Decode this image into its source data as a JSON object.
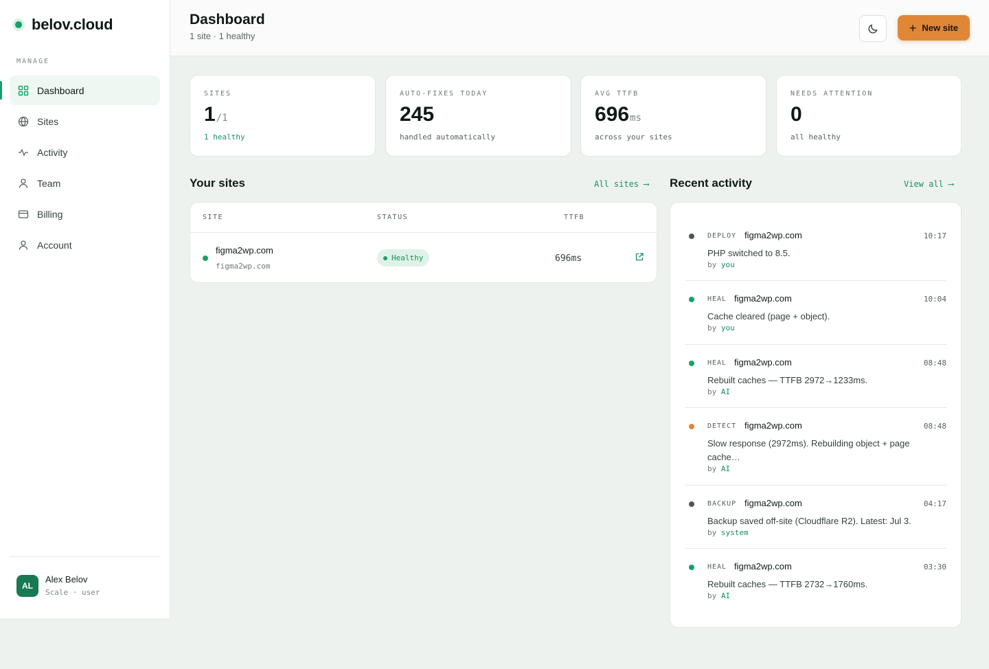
{
  "brand": {
    "name": "belov.cloud"
  },
  "sidebar": {
    "heading": "MANAGE",
    "items": [
      {
        "label": "Dashboard",
        "icon": "grid-icon",
        "active": true
      },
      {
        "label": "Sites",
        "icon": "globe-icon"
      },
      {
        "label": "Activity",
        "icon": "pulse-icon"
      },
      {
        "label": "Team",
        "icon": "person-icon"
      },
      {
        "label": "Billing",
        "icon": "card-icon"
      },
      {
        "label": "Account",
        "icon": "person-icon"
      }
    ],
    "user": {
      "initials": "AL",
      "name": "Alex Belov",
      "plan": "Scale · user"
    }
  },
  "header": {
    "title": "Dashboard",
    "subtitle": "1 site · 1 healthy",
    "theme_icon": "moon-icon",
    "new_site_label": "New site"
  },
  "stats": [
    {
      "label": "SITES",
      "value": "1",
      "unit": "/1",
      "note": "1 healthy",
      "note_color": "#15925f"
    },
    {
      "label": "AUTO-FIXES TODAY",
      "value": "245",
      "unit": "",
      "note": "handled automatically"
    },
    {
      "label": "AVG TTFB",
      "value": "696",
      "unit": "ms",
      "note": "across your sites"
    },
    {
      "label": "NEEDS ATTENTION",
      "value": "0",
      "unit": "",
      "note": "all healthy"
    }
  ],
  "sites_section": {
    "title": "Your sites",
    "link": "All sites ⟶",
    "columns": [
      "SITE",
      "STATUS",
      "TTFB"
    ],
    "rows": [
      {
        "name": "figma2wp.com",
        "host": "figma2wp.com",
        "status": "Healthy",
        "ttfb": "696ms"
      }
    ]
  },
  "activity_section": {
    "title": "Recent activity",
    "link": "View all ⟶",
    "items": [
      {
        "type": "DEPLOY",
        "site": "figma2wp.com",
        "time": "10:17",
        "text": "PHP switched to 8.5.",
        "by": "you",
        "dot": "#4c5752"
      },
      {
        "type": "HEAL",
        "site": "figma2wp.com",
        "time": "10:04",
        "text": "Cache cleared (page + object).",
        "by": "you",
        "dot": "#15a06a"
      },
      {
        "type": "HEAL",
        "site": "figma2wp.com",
        "time": "08:48",
        "text": "Rebuilt caches — TTFB 2972→1233ms.",
        "by": "AI",
        "dot": "#15a06a"
      },
      {
        "type": "DETECT",
        "site": "figma2wp.com",
        "time": "08:48",
        "text": "Slow response (2972ms). Rebuilding object + page cache…",
        "by": "AI",
        "dot": "#df8737"
      },
      {
        "type": "BACKUP",
        "site": "figma2wp.com",
        "time": "04:17",
        "text": "Backup saved off-site (Cloudflare R2). Latest: Jul 3.",
        "by": "system",
        "dot": "#4c5752"
      },
      {
        "type": "HEAL",
        "site": "figma2wp.com",
        "time": "03:30",
        "text": "Rebuilt caches — TTFB 2732→1760ms.",
        "by": "AI",
        "dot": "#15a06a"
      }
    ],
    "by_prefix": "by"
  }
}
